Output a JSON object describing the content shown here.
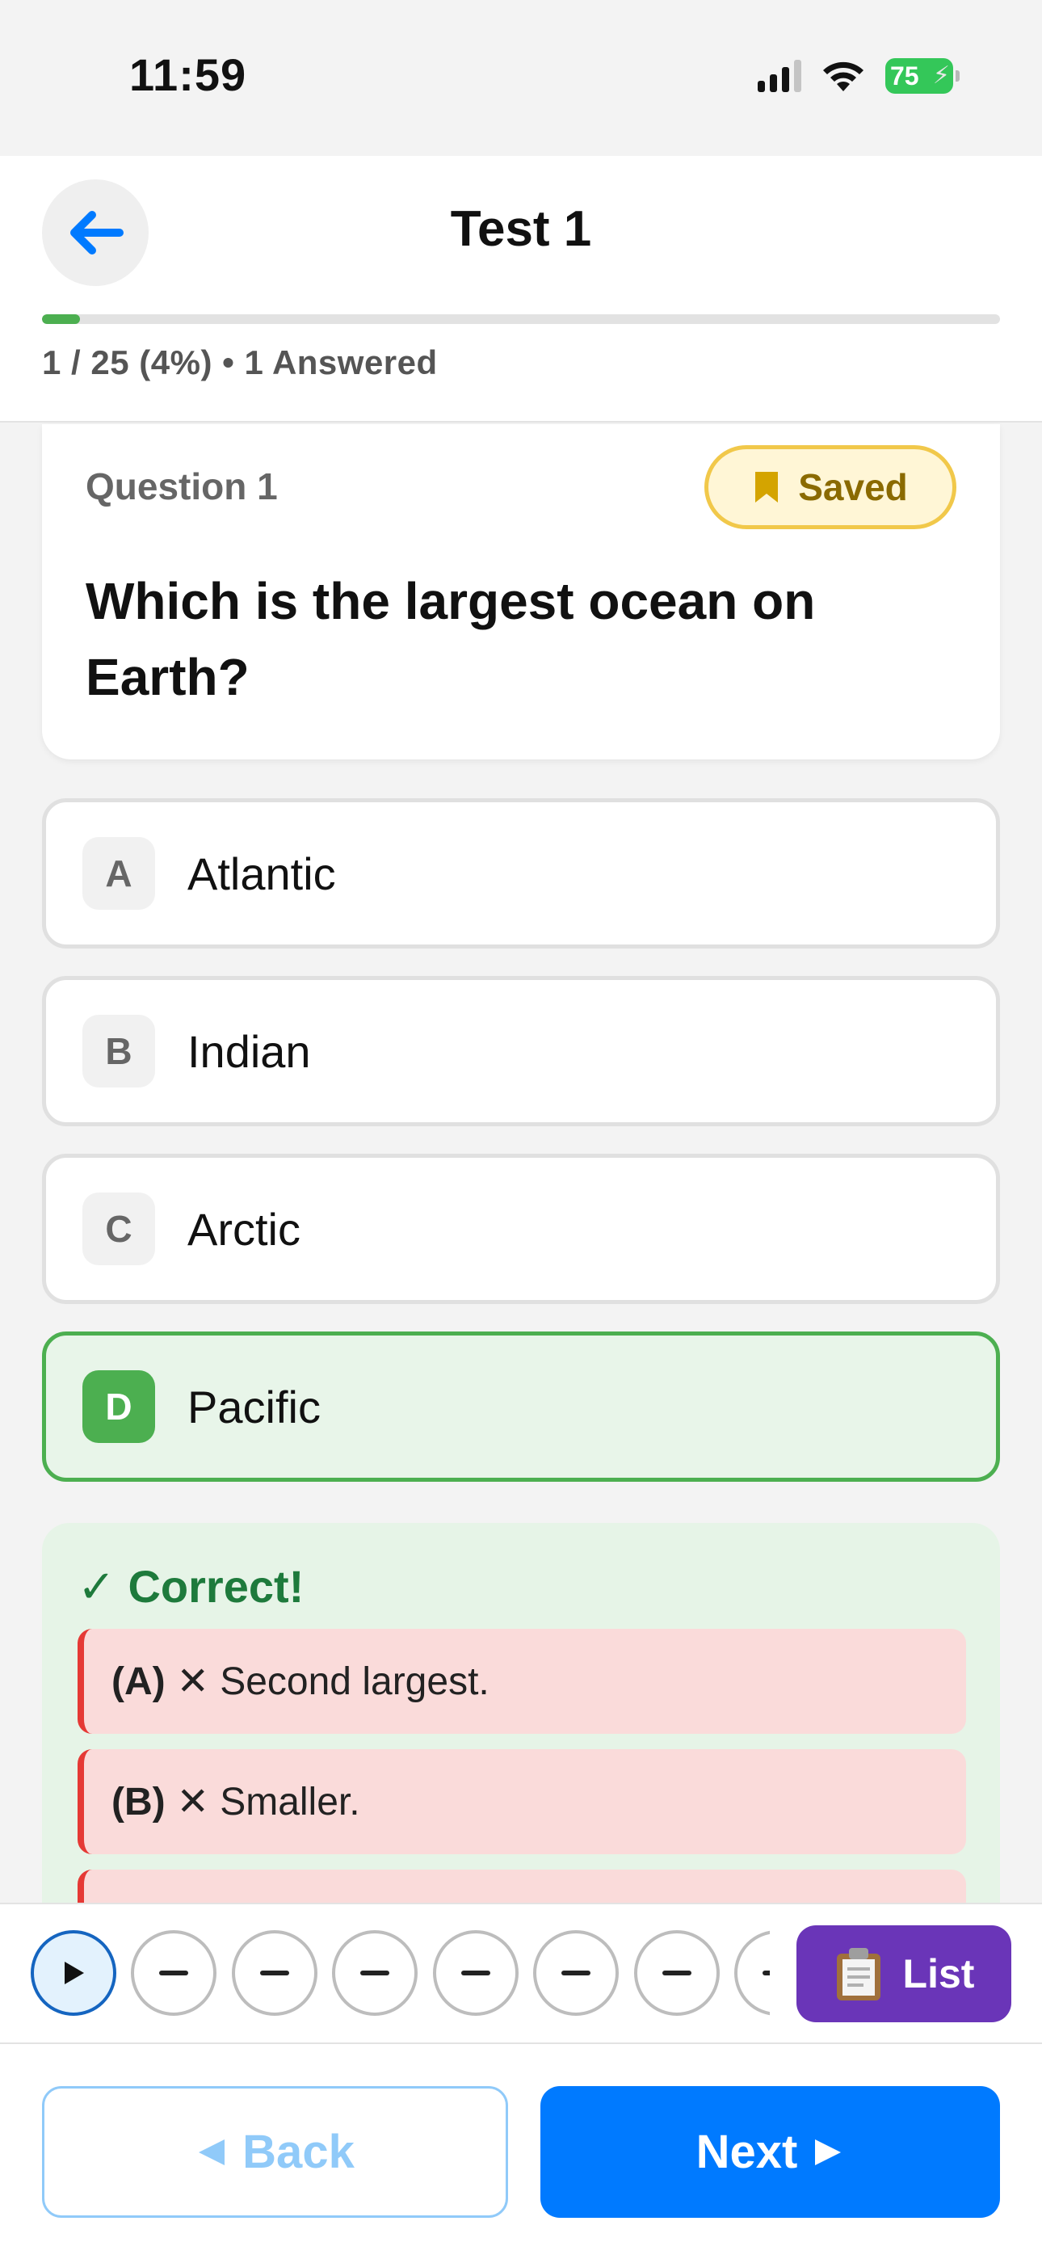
{
  "status_bar": {
    "time": "11:59",
    "battery": "75",
    "icons": [
      "cellular-signal-icon",
      "wifi-icon",
      "battery-charging-icon"
    ]
  },
  "header": {
    "title": "Test 1",
    "back_icon": "arrow-left-icon",
    "progress_fraction": 0.04,
    "progress_text": "1 / 25 (4%) • 1 Answered"
  },
  "question": {
    "number_label": "Question 1",
    "saved_label": "Saved",
    "saved_icon": "bookmark-icon",
    "text": "Which is the largest ocean on Earth?"
  },
  "options": [
    {
      "letter": "A",
      "text": "Atlantic",
      "state": "default"
    },
    {
      "letter": "B",
      "text": "Indian",
      "state": "default"
    },
    {
      "letter": "C",
      "text": "Arctic",
      "state": "default"
    },
    {
      "letter": "D",
      "text": "Pacific",
      "state": "correct"
    }
  ],
  "feedback": {
    "title": "✓ Correct!",
    "explanations": [
      {
        "tag": "(A)",
        "text": "✕ Second largest."
      },
      {
        "tag": "(B)",
        "text": "✕ Smaller."
      }
    ]
  },
  "navigator": {
    "current_icon": "play-icon",
    "list_label": "List",
    "list_icon": "clipboard-icon"
  },
  "buttons": {
    "back_label": "Back",
    "next_label": "Next"
  },
  "colors": {
    "accent_blue": "#007aff",
    "correct_green": "#4caf50",
    "wrong_red": "#e53935",
    "saved_yellow": "#f1c84a",
    "list_purple": "#6a35b8"
  }
}
